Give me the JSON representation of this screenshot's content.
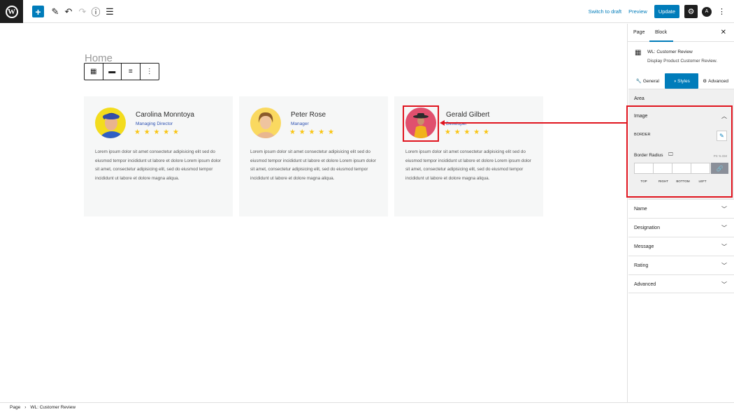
{
  "topbar": {
    "wp_logo": "W",
    "add_icon": "+",
    "edit_icon": "✎",
    "undo_icon": "↶",
    "redo_icon": "↷",
    "info_icon": "ⓘ",
    "list_icon": "☰",
    "switch_to_draft": "Switch to draft",
    "preview": "Preview",
    "update": "Update",
    "settings_icon": "⚙",
    "astra_icon": "A",
    "more_icon": "⋮"
  },
  "canvas": {
    "page_title": "Home",
    "toolbar_icons": [
      "▦",
      "▬",
      "≡",
      "⋮"
    ]
  },
  "cards": [
    {
      "name": "Carolina Monntoya",
      "role": "Managing Director",
      "stars": "★ ★ ★ ★ ★",
      "message": "Lorem ipsum dolor sit amet consectetur adipisicing elit sed do eiusmod tempor incididunt ut labore et dolore Lorem ipsum dolor sit amet, consectetur adipisicing elit, sed do eiusmod tempor incididunt ut labore et dolore magna aliqua."
    },
    {
      "name": "Peter Rose",
      "role": "Manager",
      "stars": "★ ★ ★ ★ ★",
      "message": "Lorem ipsum dolor sit amet consectetur adipisicing elit sed do eiusmod tempor incididunt ut labore et dolore Lorem ipsum dolor sit amet, consectetur adipisicing elit, sed do eiusmod tempor incididunt ut labore et dolore magna aliqua."
    },
    {
      "name": "Gerald Gilbert",
      "role": "Developer",
      "stars": "★ ★ ★ ★ ★",
      "message": "Lorem ipsum dolor sit amet consectetur adipisicing elit sed do eiusmod tempor incididunt ut labore et dolore Lorem ipsum dolor sit amet, consectetur adipisicing elit, sed do eiusmod tempor incididunt ut labore et dolore magna aliqua."
    }
  ],
  "sidebar": {
    "tab_page": "Page",
    "tab_block": "Block",
    "close_icon": "✕",
    "block_icon": "▦",
    "block_title": "WL: Customer Review",
    "block_desc": "Display Product Customer Review.",
    "style_tabs": {
      "general": "General",
      "styles": "Styles",
      "advanced": "Advanced"
    },
    "panels": {
      "area": "Area",
      "image": "Image",
      "name": "Name",
      "designation": "Designation",
      "message": "Message",
      "rating": "Rating",
      "advanced": "Advanced"
    },
    "image_panel": {
      "border_label": "BORDER",
      "border_radius_label": "Border Radius",
      "device_icon": "🖵",
      "units": "PX  %  EM",
      "caps": [
        "TOP",
        "RIGHT",
        "BOTTOM",
        "LEFT"
      ]
    }
  },
  "status_bar": {
    "crumb_page": "Page",
    "separator": "›",
    "crumb_block": "WL: Customer Review"
  },
  "colors": {
    "accent": "#007cba",
    "highlight": "#e0141e",
    "star": "#f9c513",
    "role": "#2e52b2"
  }
}
